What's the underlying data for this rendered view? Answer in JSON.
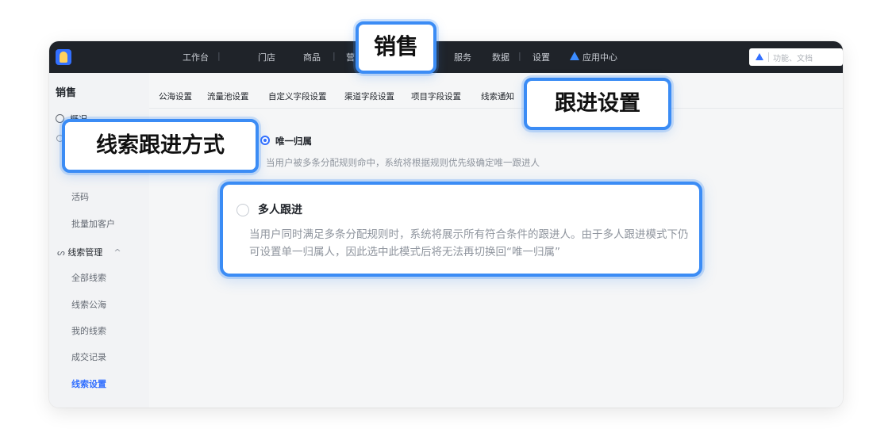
{
  "topbar": {
    "nav_items": [
      "工作台",
      "门店",
      "商品",
      "营",
      "服务",
      "数据",
      "设置",
      "应用中心"
    ],
    "search_placeholder": "功能、文档"
  },
  "sidebar": {
    "title": "销售",
    "items": {
      "overview": "概况",
      "live_code": "活码",
      "bulk_add": "批量加客户",
      "lead_group": "线索管理",
      "all_leads": "全部线索",
      "lead_pool": "线索公海",
      "my_leads": "我的线索",
      "deals": "成交记录",
      "lead_settings": "线索设置"
    }
  },
  "subtabs": [
    "公海设置",
    "流量池设置",
    "自定义字段设置",
    "渠道字段设置",
    "项目字段设置",
    "线索通知"
  ],
  "follow_mode": {
    "option1": {
      "label": "唯一归属",
      "desc": "当用户被多条分配规则命中，系统将根据规则优先级确定唯一跟进人",
      "checked": true
    },
    "option2": {
      "label": "多人跟进",
      "desc": "当用户同时满足多条分配规则时，系统将展示所有符合条件的跟进人。由于多人跟进模式下仍可设置单一归属人，因此选中此模式后将无法再切换回“唯一归属”",
      "checked": false
    }
  },
  "callouts": {
    "sales": "销售",
    "follow_settings": "跟进设置",
    "follow_method": "线索跟进方式"
  },
  "colors": {
    "accent": "#3370ff",
    "callout_border": "#3b8cf5",
    "topbar_bg": "#1f2329"
  }
}
